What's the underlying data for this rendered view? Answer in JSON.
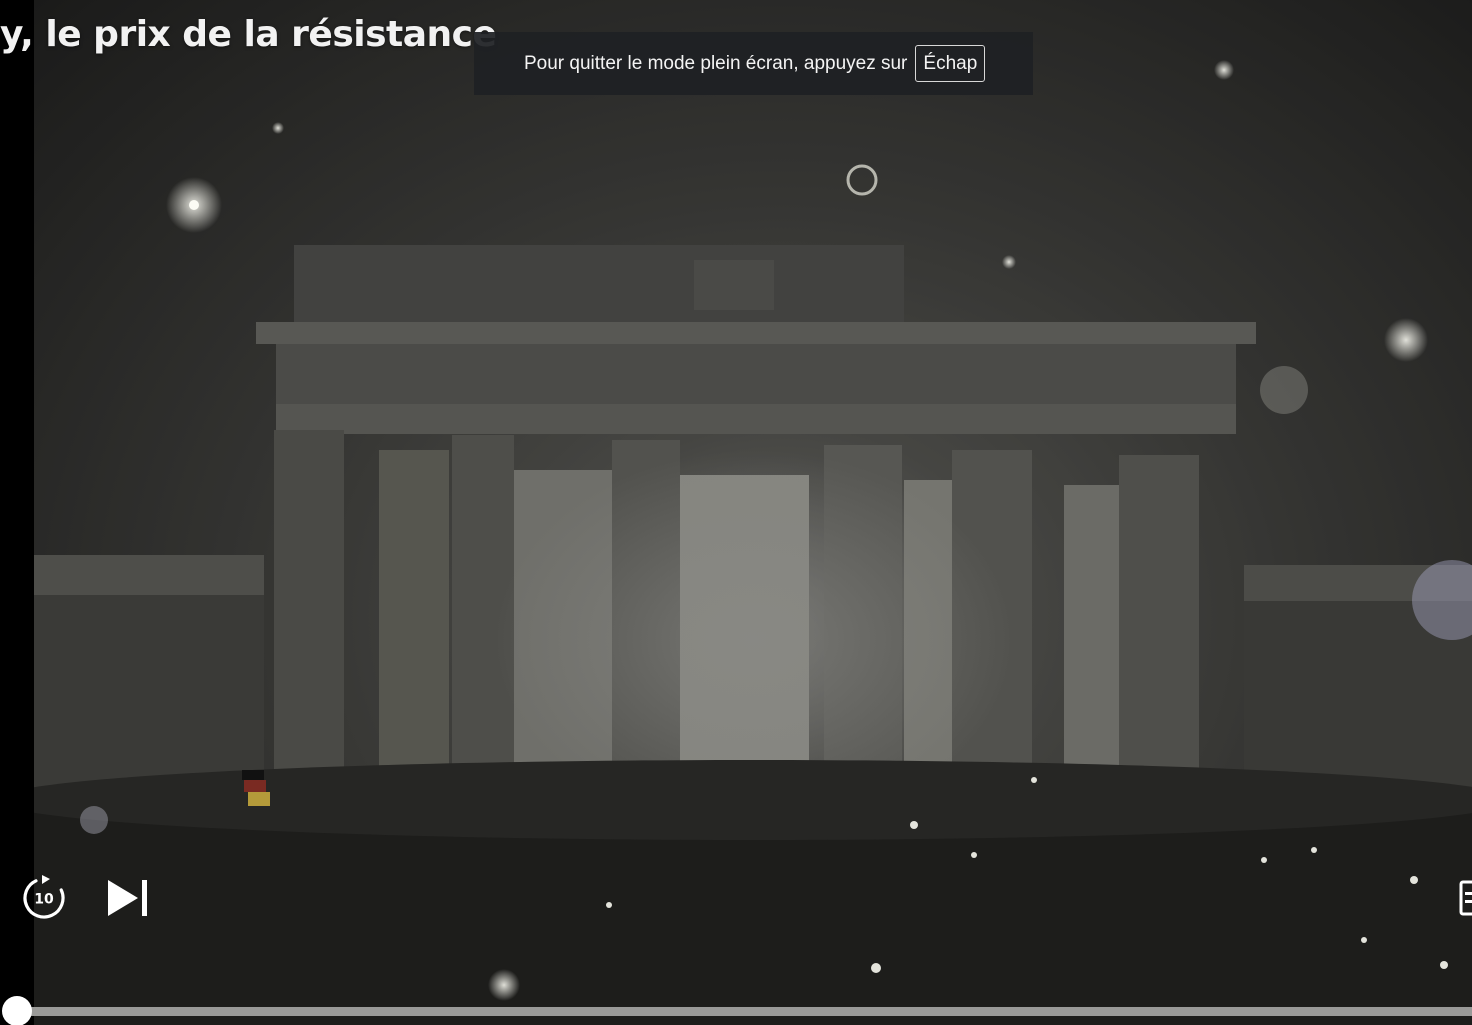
{
  "video": {
    "title": "y, le prix de la résistance",
    "progress_percent": 0.2
  },
  "fullscreen_notice": {
    "text": "Pour quitter le mode plein écran, appuyez sur",
    "key_label": "Échap"
  },
  "controls": {
    "replay_seconds": "10",
    "replay_icon": "replay-10-icon",
    "next_icon": "skip-next-icon",
    "subtitles_icon": "subtitles-icon"
  },
  "colors": {
    "toast_background": "#1e2024",
    "progress_track": "#9a9a98",
    "progress_thumb": "#ffffff"
  }
}
